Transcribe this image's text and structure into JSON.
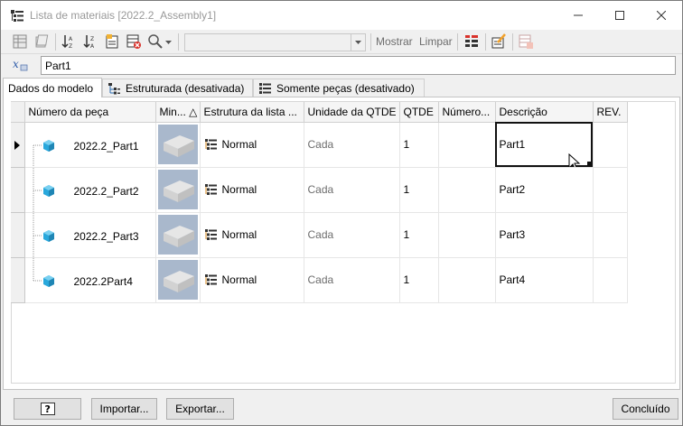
{
  "window": {
    "title": "Lista de materiais [2022.2_Assembly1]"
  },
  "toolbar": {
    "combo_value": "",
    "show_label": "Mostrar",
    "clear_label": "Limpar"
  },
  "formula": {
    "icon_label": "x",
    "value": "Part1"
  },
  "tabs": [
    {
      "label": "Dados do modelo"
    },
    {
      "label": "Estruturada (desativada)"
    },
    {
      "label": "Somente peças (desativado)"
    }
  ],
  "columns": [
    "Número da peça",
    "Min... △",
    "Estrutura da lista ...",
    "Unidade da QTDE",
    "QTDE",
    "Número...",
    "Descrição",
    "REV."
  ],
  "rows": [
    {
      "part": "2022.2_Part1",
      "structure": "Normal",
      "unit": "Cada",
      "qty": "1",
      "number": "",
      "description": "Part1",
      "rev": ""
    },
    {
      "part": "2022.2_Part2",
      "structure": "Normal",
      "unit": "Cada",
      "qty": "1",
      "number": "",
      "description": "Part2",
      "rev": ""
    },
    {
      "part": "2022.2_Part3",
      "structure": "Normal",
      "unit": "Cada",
      "qty": "1",
      "number": "",
      "description": "Part3",
      "rev": ""
    },
    {
      "part": "2022.2Part4",
      "structure": "Normal",
      "unit": "Cada",
      "qty": "1",
      "number": "",
      "description": "Part4",
      "rev": ""
    }
  ],
  "buttons": {
    "import": "Importar...",
    "export": "Exportar...",
    "done": "Concluído"
  },
  "colors": {
    "part_icon": "#29a8dc",
    "selection": "#111111"
  }
}
